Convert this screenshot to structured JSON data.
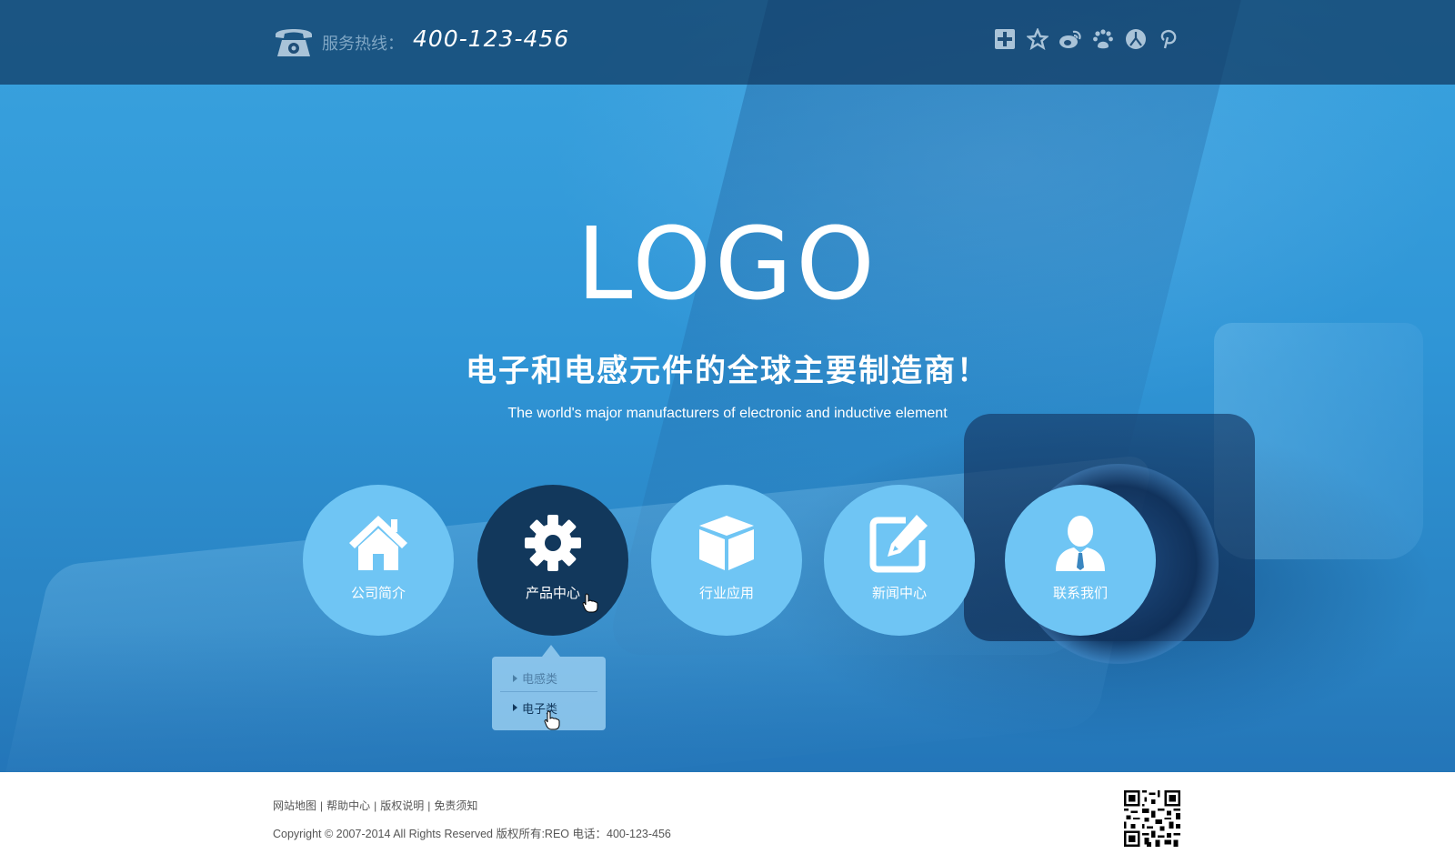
{
  "topbar": {
    "hotline_label": "服务热线：",
    "hotline_number": "400-123-456",
    "share_icons": [
      "plus-square-icon",
      "star-icon",
      "weibo-icon",
      "baidu-icon",
      "renren-icon",
      "pinterest-icon"
    ]
  },
  "hero": {
    "logo": "LOGO",
    "slogan_cn": "电子和电感元件的全球主要制造商！",
    "slogan_en": "The world's major manufacturers of electronic and inductive element"
  },
  "nav": {
    "items": [
      {
        "label": "公司简介",
        "icon": "home-icon"
      },
      {
        "label": "产品中心",
        "icon": "gear-icon",
        "active": true
      },
      {
        "label": "行业应用",
        "icon": "box-icon"
      },
      {
        "label": "新闻中心",
        "icon": "edit-icon"
      },
      {
        "label": "联系我们",
        "icon": "user-icon"
      }
    ],
    "submenu": [
      "电感类",
      "电子类"
    ]
  },
  "footer": {
    "links": [
      "网站地图",
      "帮助中心",
      "版权说明",
      "免责须知"
    ],
    "copyright": "Copyright © 2007-2014 All Rights Reserved 版权所有:REO 电话：400-123-456"
  },
  "colors": {
    "topbar": "#0f375f",
    "nav_circle": "#6fc5f4",
    "nav_active": "#12385c",
    "hero_blue": "#2f95d6"
  }
}
